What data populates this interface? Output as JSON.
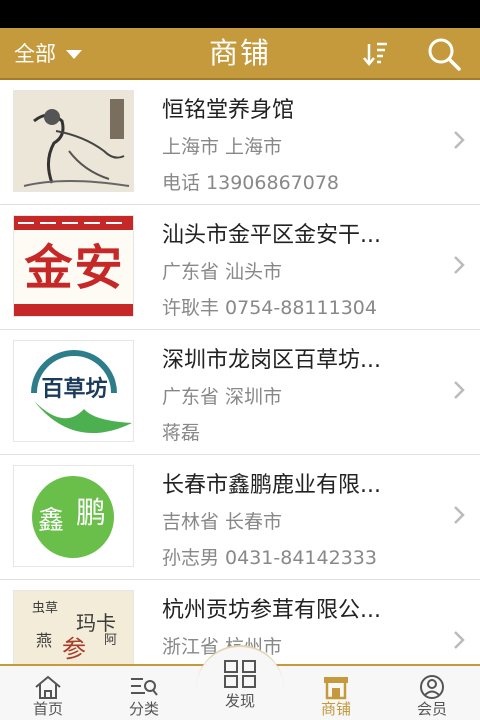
{
  "header": {
    "filter_label": "全部",
    "title": "商铺"
  },
  "shops": [
    {
      "name": "恒铭堂养身馆",
      "region": "上海市 上海市",
      "contact": "电话 13906867078",
      "image": "ink-painting"
    },
    {
      "name": "汕头市金平区金安干...",
      "region": "广东省 汕头市",
      "contact": "许耿丰 0754-88111304",
      "image": "jinan-logo"
    },
    {
      "name": "深圳市龙岗区百草坊...",
      "region": "广东省 深圳市",
      "contact": "蒋磊",
      "image": "baicaofang-logo"
    },
    {
      "name": "长春市鑫鹏鹿业有限...",
      "region": "吉林省 长春市",
      "contact": "孙志男 0431-84142333",
      "image": "xinpeng-logo"
    },
    {
      "name": "杭州贡坊参茸有限公...",
      "region": "浙江省 杭州市",
      "contact": "",
      "image": "calligraphy-logo"
    }
  ],
  "thumb_text": {
    "jinan": "金安",
    "baicaofang": "百草坊",
    "xinpeng": "鑫",
    "xinpeng2": "鹏",
    "callig_a": "虫草",
    "callig_b": "玛卡",
    "callig_c": "燕",
    "callig_d": "参",
    "callig_e": "阿"
  },
  "tabs": [
    {
      "label": "首页",
      "icon": "home-icon"
    },
    {
      "label": "分类",
      "icon": "category-icon"
    },
    {
      "label": "发现",
      "icon": "grid-icon"
    },
    {
      "label": "商铺",
      "icon": "shop-icon",
      "active": true
    },
    {
      "label": "会员",
      "icon": "user-icon"
    }
  ],
  "colors": {
    "accent": "#c49a3c",
    "text": "#222222",
    "muted": "#888888"
  }
}
